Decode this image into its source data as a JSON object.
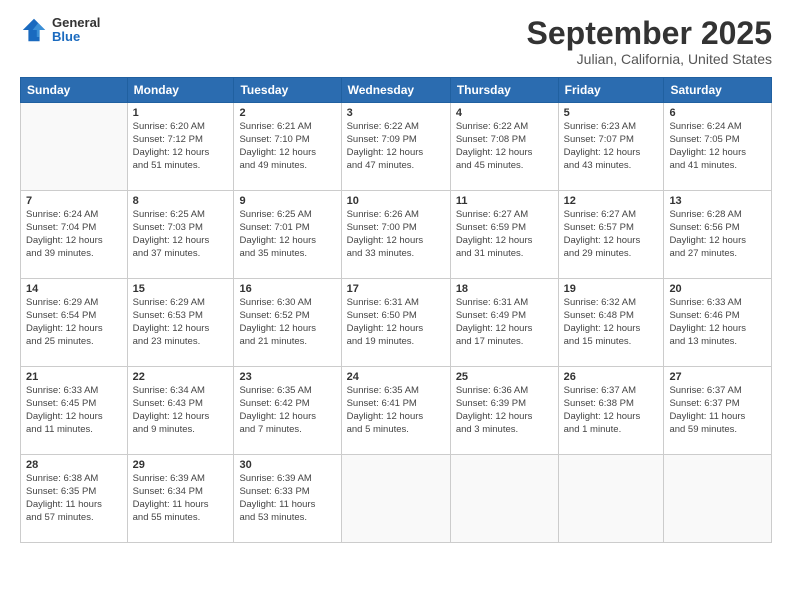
{
  "header": {
    "logo_general": "General",
    "logo_blue": "Blue",
    "month_title": "September 2025",
    "location": "Julian, California, United States"
  },
  "days_of_week": [
    "Sunday",
    "Monday",
    "Tuesday",
    "Wednesday",
    "Thursday",
    "Friday",
    "Saturday"
  ],
  "weeks": [
    [
      {
        "num": "",
        "info": ""
      },
      {
        "num": "1",
        "info": "Sunrise: 6:20 AM\nSunset: 7:12 PM\nDaylight: 12 hours\nand 51 minutes."
      },
      {
        "num": "2",
        "info": "Sunrise: 6:21 AM\nSunset: 7:10 PM\nDaylight: 12 hours\nand 49 minutes."
      },
      {
        "num": "3",
        "info": "Sunrise: 6:22 AM\nSunset: 7:09 PM\nDaylight: 12 hours\nand 47 minutes."
      },
      {
        "num": "4",
        "info": "Sunrise: 6:22 AM\nSunset: 7:08 PM\nDaylight: 12 hours\nand 45 minutes."
      },
      {
        "num": "5",
        "info": "Sunrise: 6:23 AM\nSunset: 7:07 PM\nDaylight: 12 hours\nand 43 minutes."
      },
      {
        "num": "6",
        "info": "Sunrise: 6:24 AM\nSunset: 7:05 PM\nDaylight: 12 hours\nand 41 minutes."
      }
    ],
    [
      {
        "num": "7",
        "info": "Sunrise: 6:24 AM\nSunset: 7:04 PM\nDaylight: 12 hours\nand 39 minutes."
      },
      {
        "num": "8",
        "info": "Sunrise: 6:25 AM\nSunset: 7:03 PM\nDaylight: 12 hours\nand 37 minutes."
      },
      {
        "num": "9",
        "info": "Sunrise: 6:25 AM\nSunset: 7:01 PM\nDaylight: 12 hours\nand 35 minutes."
      },
      {
        "num": "10",
        "info": "Sunrise: 6:26 AM\nSunset: 7:00 PM\nDaylight: 12 hours\nand 33 minutes."
      },
      {
        "num": "11",
        "info": "Sunrise: 6:27 AM\nSunset: 6:59 PM\nDaylight: 12 hours\nand 31 minutes."
      },
      {
        "num": "12",
        "info": "Sunrise: 6:27 AM\nSunset: 6:57 PM\nDaylight: 12 hours\nand 29 minutes."
      },
      {
        "num": "13",
        "info": "Sunrise: 6:28 AM\nSunset: 6:56 PM\nDaylight: 12 hours\nand 27 minutes."
      }
    ],
    [
      {
        "num": "14",
        "info": "Sunrise: 6:29 AM\nSunset: 6:54 PM\nDaylight: 12 hours\nand 25 minutes."
      },
      {
        "num": "15",
        "info": "Sunrise: 6:29 AM\nSunset: 6:53 PM\nDaylight: 12 hours\nand 23 minutes."
      },
      {
        "num": "16",
        "info": "Sunrise: 6:30 AM\nSunset: 6:52 PM\nDaylight: 12 hours\nand 21 minutes."
      },
      {
        "num": "17",
        "info": "Sunrise: 6:31 AM\nSunset: 6:50 PM\nDaylight: 12 hours\nand 19 minutes."
      },
      {
        "num": "18",
        "info": "Sunrise: 6:31 AM\nSunset: 6:49 PM\nDaylight: 12 hours\nand 17 minutes."
      },
      {
        "num": "19",
        "info": "Sunrise: 6:32 AM\nSunset: 6:48 PM\nDaylight: 12 hours\nand 15 minutes."
      },
      {
        "num": "20",
        "info": "Sunrise: 6:33 AM\nSunset: 6:46 PM\nDaylight: 12 hours\nand 13 minutes."
      }
    ],
    [
      {
        "num": "21",
        "info": "Sunrise: 6:33 AM\nSunset: 6:45 PM\nDaylight: 12 hours\nand 11 minutes."
      },
      {
        "num": "22",
        "info": "Sunrise: 6:34 AM\nSunset: 6:43 PM\nDaylight: 12 hours\nand 9 minutes."
      },
      {
        "num": "23",
        "info": "Sunrise: 6:35 AM\nSunset: 6:42 PM\nDaylight: 12 hours\nand 7 minutes."
      },
      {
        "num": "24",
        "info": "Sunrise: 6:35 AM\nSunset: 6:41 PM\nDaylight: 12 hours\nand 5 minutes."
      },
      {
        "num": "25",
        "info": "Sunrise: 6:36 AM\nSunset: 6:39 PM\nDaylight: 12 hours\nand 3 minutes."
      },
      {
        "num": "26",
        "info": "Sunrise: 6:37 AM\nSunset: 6:38 PM\nDaylight: 12 hours\nand 1 minute."
      },
      {
        "num": "27",
        "info": "Sunrise: 6:37 AM\nSunset: 6:37 PM\nDaylight: 11 hours\nand 59 minutes."
      }
    ],
    [
      {
        "num": "28",
        "info": "Sunrise: 6:38 AM\nSunset: 6:35 PM\nDaylight: 11 hours\nand 57 minutes."
      },
      {
        "num": "29",
        "info": "Sunrise: 6:39 AM\nSunset: 6:34 PM\nDaylight: 11 hours\nand 55 minutes."
      },
      {
        "num": "30",
        "info": "Sunrise: 6:39 AM\nSunset: 6:33 PM\nDaylight: 11 hours\nand 53 minutes."
      },
      {
        "num": "",
        "info": ""
      },
      {
        "num": "",
        "info": ""
      },
      {
        "num": "",
        "info": ""
      },
      {
        "num": "",
        "info": ""
      }
    ]
  ]
}
